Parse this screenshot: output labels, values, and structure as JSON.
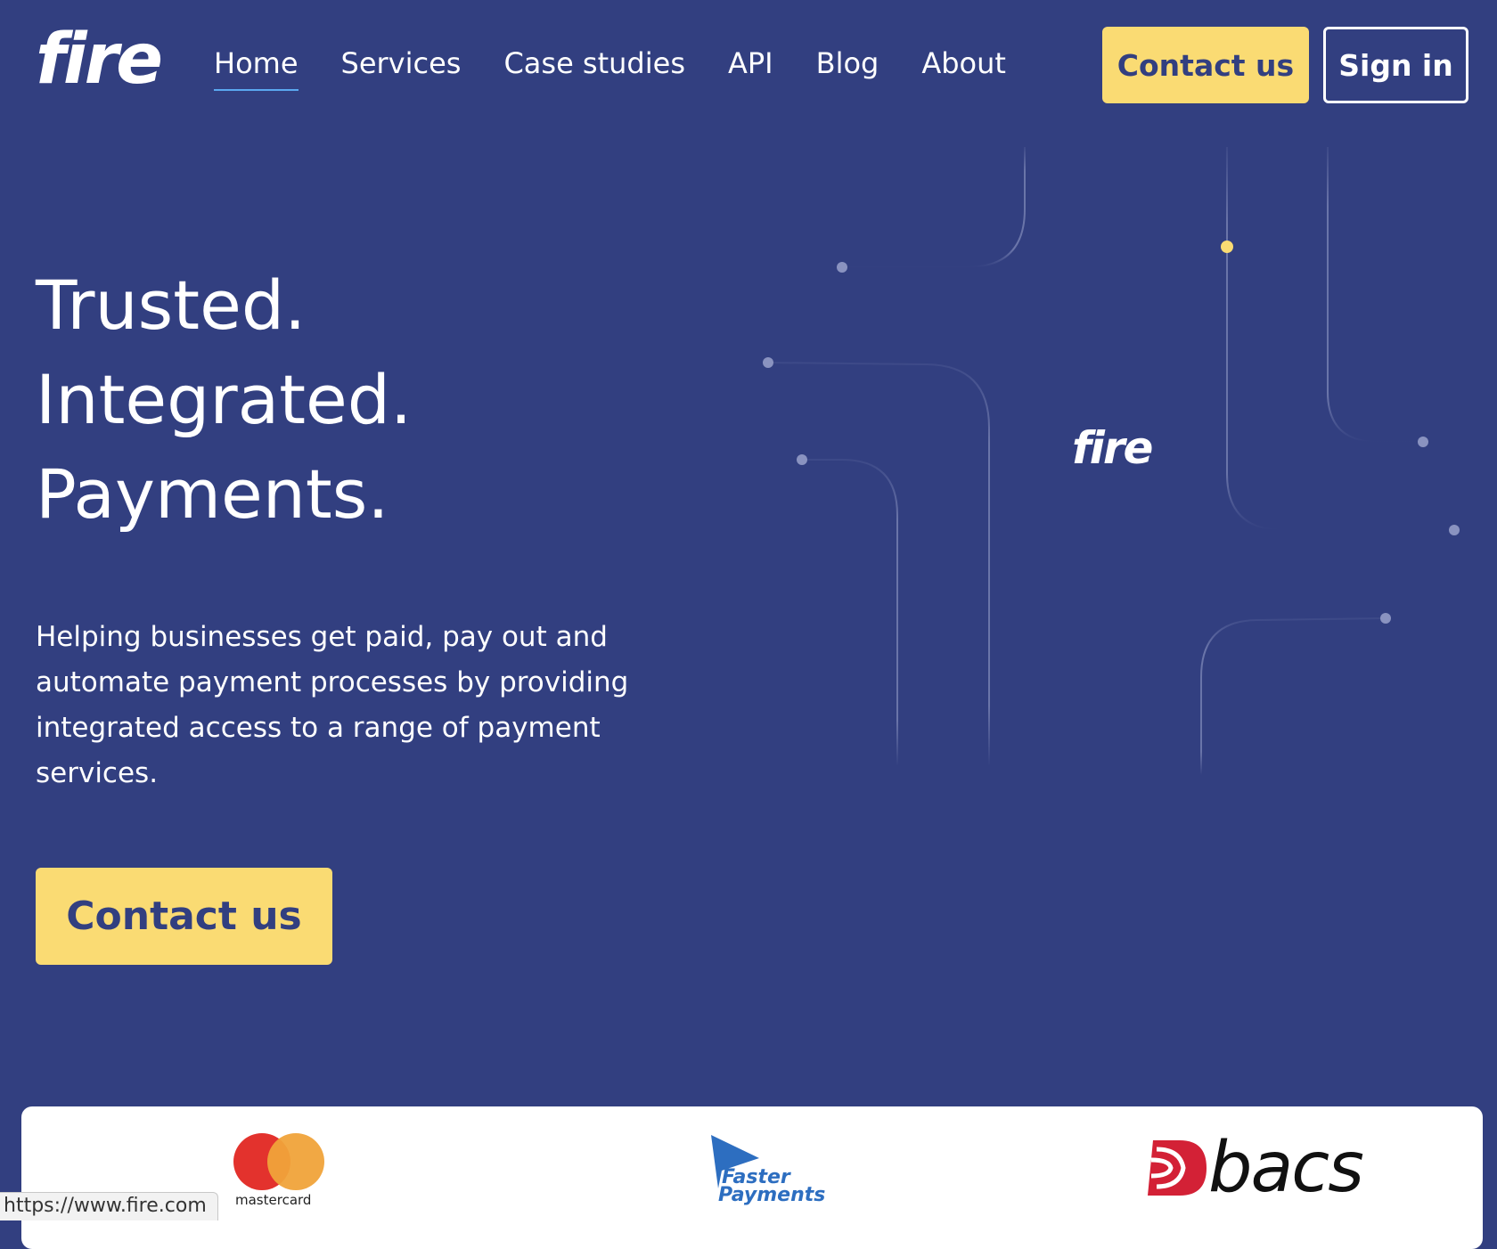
{
  "brand": {
    "logo_text": "fire",
    "graphic_logo_text": "fire"
  },
  "nav": {
    "items": [
      {
        "label": "Home",
        "active": true
      },
      {
        "label": "Services",
        "active": false
      },
      {
        "label": "Case studies",
        "active": false
      },
      {
        "label": "API",
        "active": false
      },
      {
        "label": "Blog",
        "active": false
      },
      {
        "label": "About",
        "active": false
      }
    ],
    "contact_label": "Contact us",
    "signin_label": "Sign in"
  },
  "hero": {
    "title_lines": [
      "Trusted.",
      "Integrated.",
      "Payments."
    ],
    "description": "Helping businesses get paid, pay out and automate payment processes by providing integrated access to a range of payment services.",
    "cta_label": "Contact us"
  },
  "partners": {
    "mastercard_label": "mastercard",
    "faster_payments_line1": "Faster",
    "faster_payments_line2": "Payments",
    "bacs_label": "bacs"
  },
  "status_bar": {
    "url": "https://www.fire.com"
  },
  "colors": {
    "background": "#323f80",
    "accent_yellow": "#fadb73",
    "nav_underline": "#5aa8f0",
    "mastercard_red": "#e3322d",
    "mastercard_orange": "#f0a33a",
    "faster_payments_blue": "#2d6ec0",
    "bacs_red": "#d32136"
  },
  "icons": {
    "graphic": "circuit-lines-graphic",
    "mastercard": "mastercard-logo-icon",
    "faster_payments": "faster-payments-logo-icon",
    "bacs": "bacs-logo-icon"
  }
}
